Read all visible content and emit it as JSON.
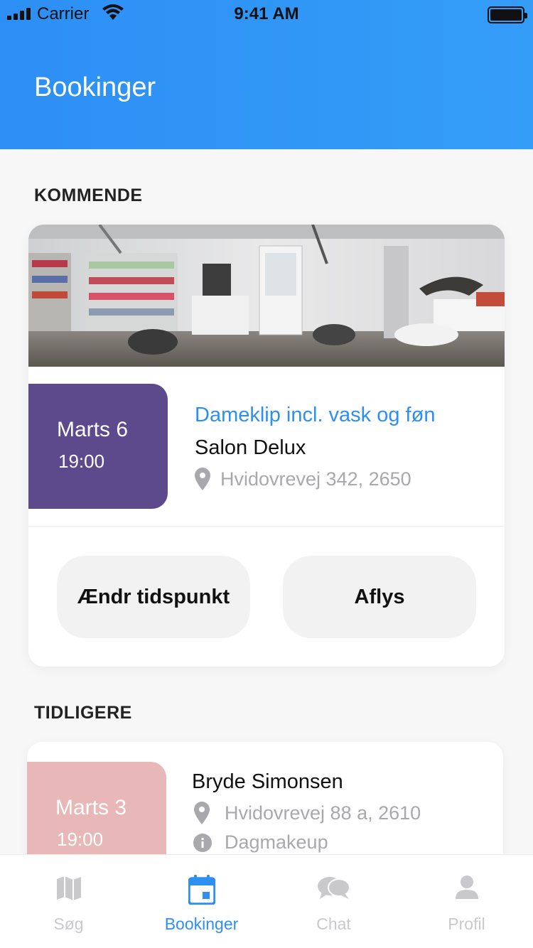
{
  "status_bar": {
    "carrier": "Carrier",
    "time": "9:41 AM"
  },
  "header": {
    "title": "Bookinger"
  },
  "upcoming": {
    "section_title": "KOMMENDE",
    "booking": {
      "date": "Marts 6",
      "time": "19:00",
      "service": "Dameklip incl. vask og føn",
      "salon": "Salon Delux",
      "address": "Hvidovrevej 342, 2650",
      "date_color": "#5c4a8c"
    },
    "buttons": {
      "change": "Ændr tidspunkt",
      "cancel": "Aflys"
    }
  },
  "past": {
    "section_title": "TIDLIGERE",
    "booking": {
      "date": "Marts 3",
      "time": "19:00",
      "name": "Bryde Simonsen",
      "address": "Hvidovrevej 88 a, 2610",
      "info": "Dagmakeup",
      "date_color": "#e8b7b8"
    }
  },
  "tabbar": {
    "items": [
      {
        "label": "Søg",
        "icon": "map-icon"
      },
      {
        "label": "Bookinger",
        "icon": "calendar-icon",
        "active": true
      },
      {
        "label": "Chat",
        "icon": "chat-icon"
      },
      {
        "label": "Profil",
        "icon": "person-icon"
      }
    ]
  },
  "colors": {
    "accent": "#2e8ff3",
    "header_gradient_start": "#2d8ff5",
    "header_gradient_end": "#349df8"
  }
}
